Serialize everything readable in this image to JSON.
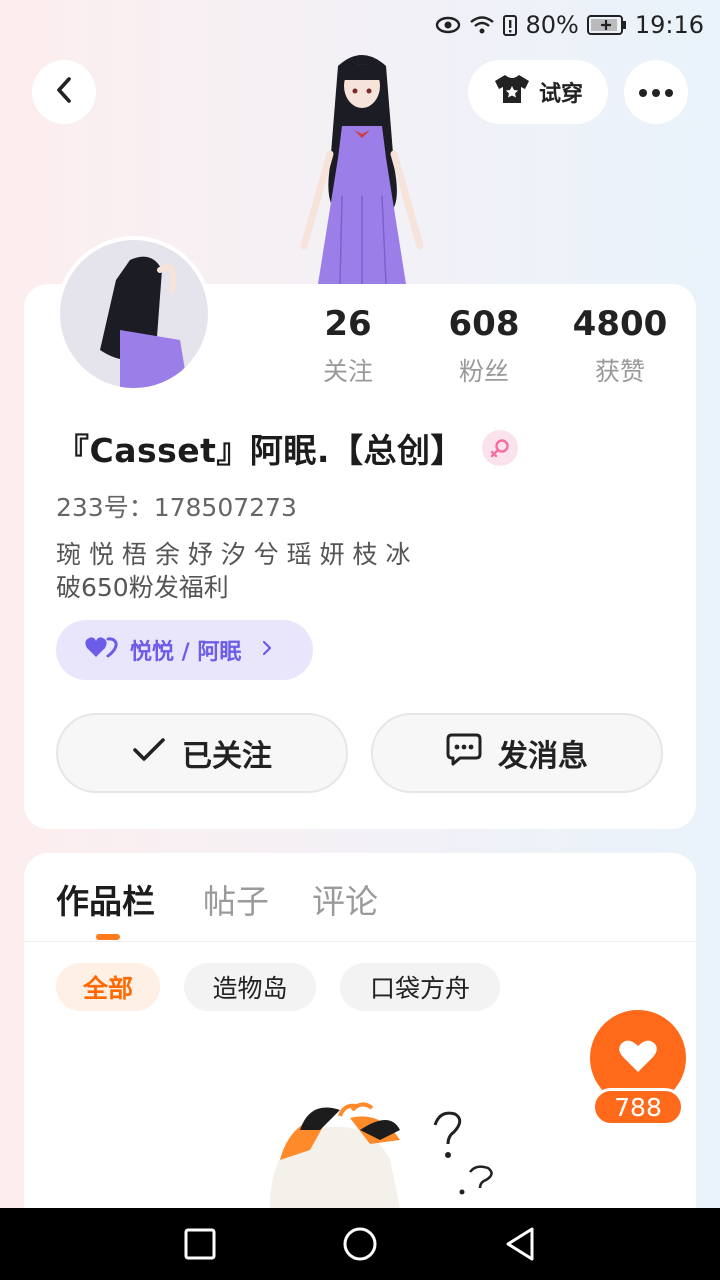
{
  "status_bar": {
    "battery": "80%",
    "time": "19:16"
  },
  "header": {
    "back_icon": "chevron-left-icon",
    "tryon_label": "试穿",
    "tryon_icon": "tshirt-icon",
    "more_icon": "more-dots-icon"
  },
  "stats": [
    {
      "value": "26",
      "label": "关注"
    },
    {
      "value": "608",
      "label": "粉丝"
    },
    {
      "value": "4800",
      "label": "获赞"
    }
  ],
  "profile": {
    "name": "『Casset』阿眠.【总创】",
    "gender_icon": "female-icon",
    "uid": "233号：178507273",
    "bio_lines": [
      "琬 悦 梧 余 妤 汐 兮 瑶 妍 枝 冰",
      "破650粉发福利"
    ],
    "cp_tag": "悦悦 / 阿眠"
  },
  "actions": {
    "follow_label": "已关注",
    "message_label": "发消息"
  },
  "tabs": [
    {
      "label": "作品栏",
      "active": true
    },
    {
      "label": "帖子",
      "active": false
    },
    {
      "label": "评论",
      "active": false
    }
  ],
  "chips": [
    {
      "label": "全部",
      "active": true
    },
    {
      "label": "造物岛",
      "active": false
    },
    {
      "label": "口袋方舟",
      "active": false
    }
  ],
  "like_fab": {
    "count": "788"
  },
  "colors": {
    "accent": "#ff6a1a",
    "cp_purple": "#6c5ce7",
    "avatar_dress": "#9c7ee8"
  }
}
